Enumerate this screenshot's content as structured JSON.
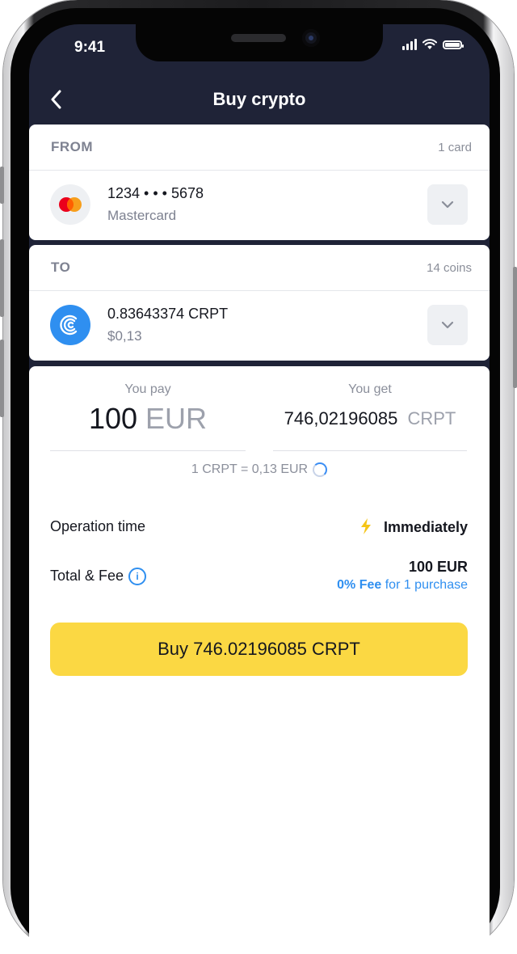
{
  "status_bar": {
    "time": "9:41"
  },
  "header": {
    "title": "Buy crypto"
  },
  "from": {
    "label": "FROM",
    "count": "1 card",
    "card_number": "1234 • • • 5678",
    "card_type": "Mastercard"
  },
  "to": {
    "label": "TO",
    "count": "14 coins",
    "amount": "0.83643374 CRPT",
    "fiat_value": "$0,13"
  },
  "exchange": {
    "pay_label": "You pay",
    "pay_amount": "100",
    "pay_currency": "EUR",
    "get_label": "You get",
    "get_amount": "746,02196085",
    "get_currency": "CRPT",
    "rate": "1 CRPT = 0,13 EUR"
  },
  "details": {
    "operation_time_label": "Operation time",
    "operation_time_value": "Immediately",
    "total_fee_label": "Total & Fee",
    "total_value": "100 EUR",
    "fee_bold": "0% Fee",
    "fee_text": "for 1 purchase"
  },
  "buy_button": {
    "label": "Buy 746.02196085 CRPT"
  },
  "colors": {
    "header_bg": "#1f2337",
    "accent_yellow": "#fbd843",
    "link_blue": "#2f8ff0",
    "coin_blue": "#2f8ff0",
    "mastercard_red": "#eb001b",
    "mastercard_orange": "#f79e1b",
    "bolt_yellow": "#f5c518"
  },
  "icons": [
    "chevron-left-icon",
    "mastercard-logo",
    "crpt-coin-icon",
    "chevron-down-icon",
    "loading-spinner-icon",
    "lightning-icon",
    "info-icon"
  ]
}
